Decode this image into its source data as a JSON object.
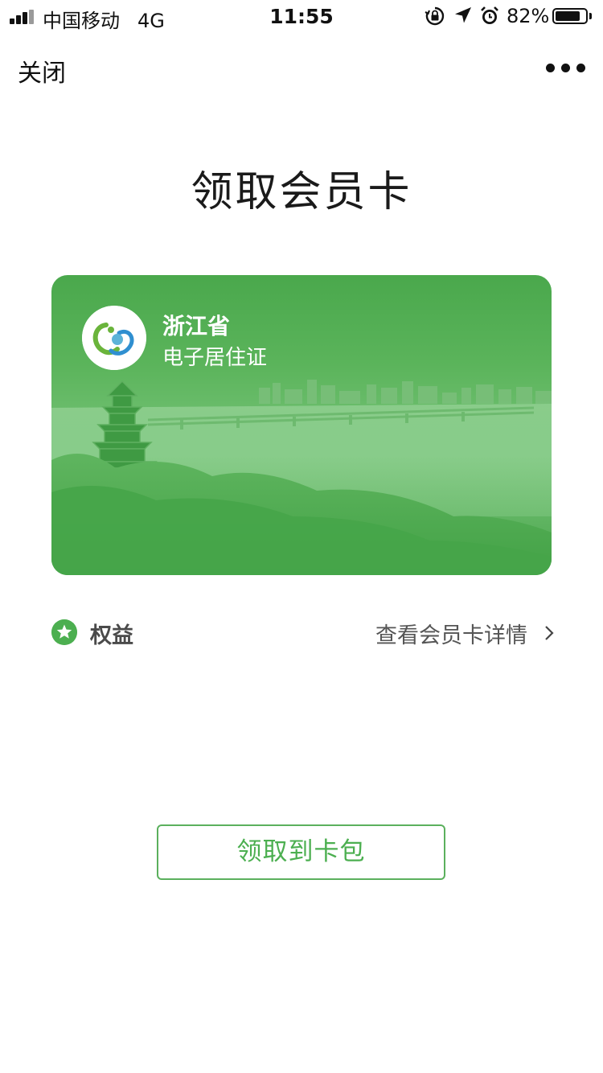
{
  "status_bar": {
    "carrier": "中国移动",
    "network": "4G",
    "time": "11:55",
    "battery_percent": "82%",
    "battery_level": 0.82,
    "icons": [
      "orientation-lock-icon",
      "location-arrow-icon",
      "alarm-icon"
    ]
  },
  "nav": {
    "close_label": "关闭",
    "more_icon": "more-dots-icon"
  },
  "page": {
    "title": "领取会员卡"
  },
  "card": {
    "issuer": "浙江省",
    "name": "电子居住证",
    "logo_icon": "residence-permit-logo",
    "background_color": "#4caf50"
  },
  "benefits": {
    "label": "权益",
    "icon": "star-badge-icon",
    "detail_link": "查看会员卡详情",
    "chevron_icon": "chevron-right-icon"
  },
  "action": {
    "button_label": "领取到卡包",
    "accent_color": "#4caf50"
  }
}
